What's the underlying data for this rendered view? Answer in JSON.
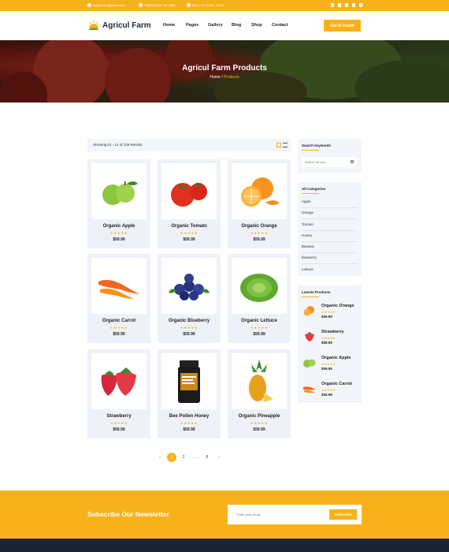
{
  "topbar": {
    "email": "AgricFarm@gmail.com",
    "phone": "+88(0)8 029 745 4982",
    "hours": "Mon - Fri 09:30 - 18:30",
    "socials": [
      "twitter-icon",
      "linkedin-icon",
      "instagram-icon",
      "vimeo-icon",
      "facebook-icon"
    ]
  },
  "header": {
    "brand": "Agricul Farm",
    "nav": [
      "Home",
      "Pages",
      "Gallery",
      "Blog",
      "Shop",
      "Contact"
    ],
    "cta": "Get in Touch"
  },
  "hero": {
    "title": "Agricul Farm Products",
    "crumb_home": "Home",
    "crumb_sep": " / ",
    "crumb_current": "Products"
  },
  "results": {
    "text": "Showing 01 - 12 of 139 Results"
  },
  "products": [
    {
      "name": "Organic Apple",
      "stars": "★★★★★",
      "price": "$59.99",
      "icon": "apple"
    },
    {
      "name": "Organic Tomato",
      "stars": "★★★★★",
      "price": "$59.99",
      "icon": "tomato"
    },
    {
      "name": "Organic Orange",
      "stars": "★★★★★",
      "price": "$59.99",
      "icon": "orange"
    },
    {
      "name": "Organic Carrot",
      "stars": "★★★★★",
      "price": "$59.99",
      "icon": "carrot"
    },
    {
      "name": "Organic Blueberry",
      "stars": "★★★★★",
      "price": "$59.99",
      "icon": "blueberry"
    },
    {
      "name": "Organic Lettuce",
      "stars": "★★★★★",
      "price": "$59.99",
      "icon": "lettuce"
    },
    {
      "name": "Strawberry",
      "stars": "★★★★★",
      "price": "$59.99",
      "icon": "strawberry"
    },
    {
      "name": "Bee Pollen Honey",
      "stars": "★★★★★",
      "price": "$59.99",
      "icon": "honey"
    },
    {
      "name": "Organic Pineapple",
      "stars": "★★★★★",
      "price": "$59.99",
      "icon": "pineapple"
    }
  ],
  "pagination": {
    "prev": "«",
    "pages": [
      "1",
      "2",
      "...",
      "8"
    ],
    "next": "»",
    "current": "1"
  },
  "sidebar": {
    "search_title": "Search keywords",
    "search_placeholder": "Search for text...",
    "categories_title": "All Categories",
    "categories": [
      "Apple",
      "Orange",
      "Tomato",
      "Honey",
      "Banana",
      "blueberry",
      "Lettuce"
    ],
    "latest_title": "Latests Products",
    "latest": [
      {
        "name": "Organic Orange",
        "stars": "★★★★★",
        "price": "$59.99",
        "icon": "orange"
      },
      {
        "name": "Strawberry",
        "stars": "★★★★★",
        "price": "$59.99",
        "icon": "strawberry"
      },
      {
        "name": "Organic Apple",
        "stars": "★★★★★",
        "price": "$59.99",
        "icon": "apple"
      },
      {
        "name": "Organic Carrot",
        "stars": "★★★★★",
        "price": "$59.99",
        "icon": "carrot"
      }
    ]
  },
  "newsletter": {
    "title": "Subscribe Our Newsletter",
    "placeholder": "Enter your Email",
    "button": "Subscribe"
  },
  "colors": {
    "accent": "#f7b21b",
    "panel": "#f2f5f9",
    "dark": "#1b2432"
  }
}
